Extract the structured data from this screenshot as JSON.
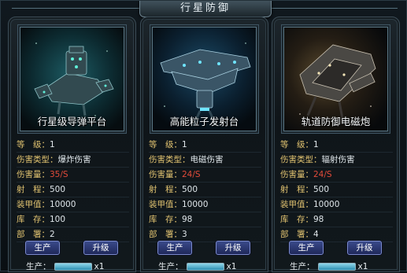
{
  "window": {
    "title": "行星防御"
  },
  "panels": [
    {
      "name": "行星级导弹平台",
      "icon": "missile-platform-art",
      "stats": [
        {
          "label": "等　级：",
          "value": "1"
        },
        {
          "label": "伤害类型：",
          "value": "爆炸伤害"
        },
        {
          "label": "伤害量：",
          "value": "35/S"
        },
        {
          "label": "射　程：",
          "value": "500"
        },
        {
          "label": "装甲值：",
          "value": "10000"
        },
        {
          "label": "库　存：",
          "value": "100"
        },
        {
          "label": "部　署：",
          "value": "2"
        }
      ],
      "produce_label": "生产",
      "upgrade_label": "升级",
      "prod_label": "生产：",
      "prod_qty": "x1"
    },
    {
      "name": "高能粒子发射台",
      "icon": "particle-launcher-art",
      "stats": [
        {
          "label": "等　级：",
          "value": "1"
        },
        {
          "label": "伤害类型：",
          "value": "电磁伤害"
        },
        {
          "label": "伤害量：",
          "value": "24/S"
        },
        {
          "label": "射　程：",
          "value": "500"
        },
        {
          "label": "装甲值：",
          "value": "10000"
        },
        {
          "label": "库　存：",
          "value": "98"
        },
        {
          "label": "部　署：",
          "value": "3"
        }
      ],
      "produce_label": "生产",
      "upgrade_label": "升级",
      "prod_label": "生产：",
      "prod_qty": "x1"
    },
    {
      "name": "轨道防御电磁炮",
      "icon": "railgun-art",
      "stats": [
        {
          "label": "等　级：",
          "value": "1"
        },
        {
          "label": "伤害类型：",
          "value": "辐射伤害"
        },
        {
          "label": "伤害量：",
          "value": "24/S"
        },
        {
          "label": "射　程：",
          "value": "500"
        },
        {
          "label": "装甲值：",
          "value": "10000"
        },
        {
          "label": "库　存：",
          "value": "98"
        },
        {
          "label": "部　署：",
          "value": "4"
        }
      ],
      "produce_label": "生产",
      "upgrade_label": "升级",
      "prod_label": "生产：",
      "prod_qty": "x1"
    }
  ],
  "colors": {
    "label": "#e0c270",
    "damage": "#e24b3a",
    "button": "#2b3770"
  }
}
